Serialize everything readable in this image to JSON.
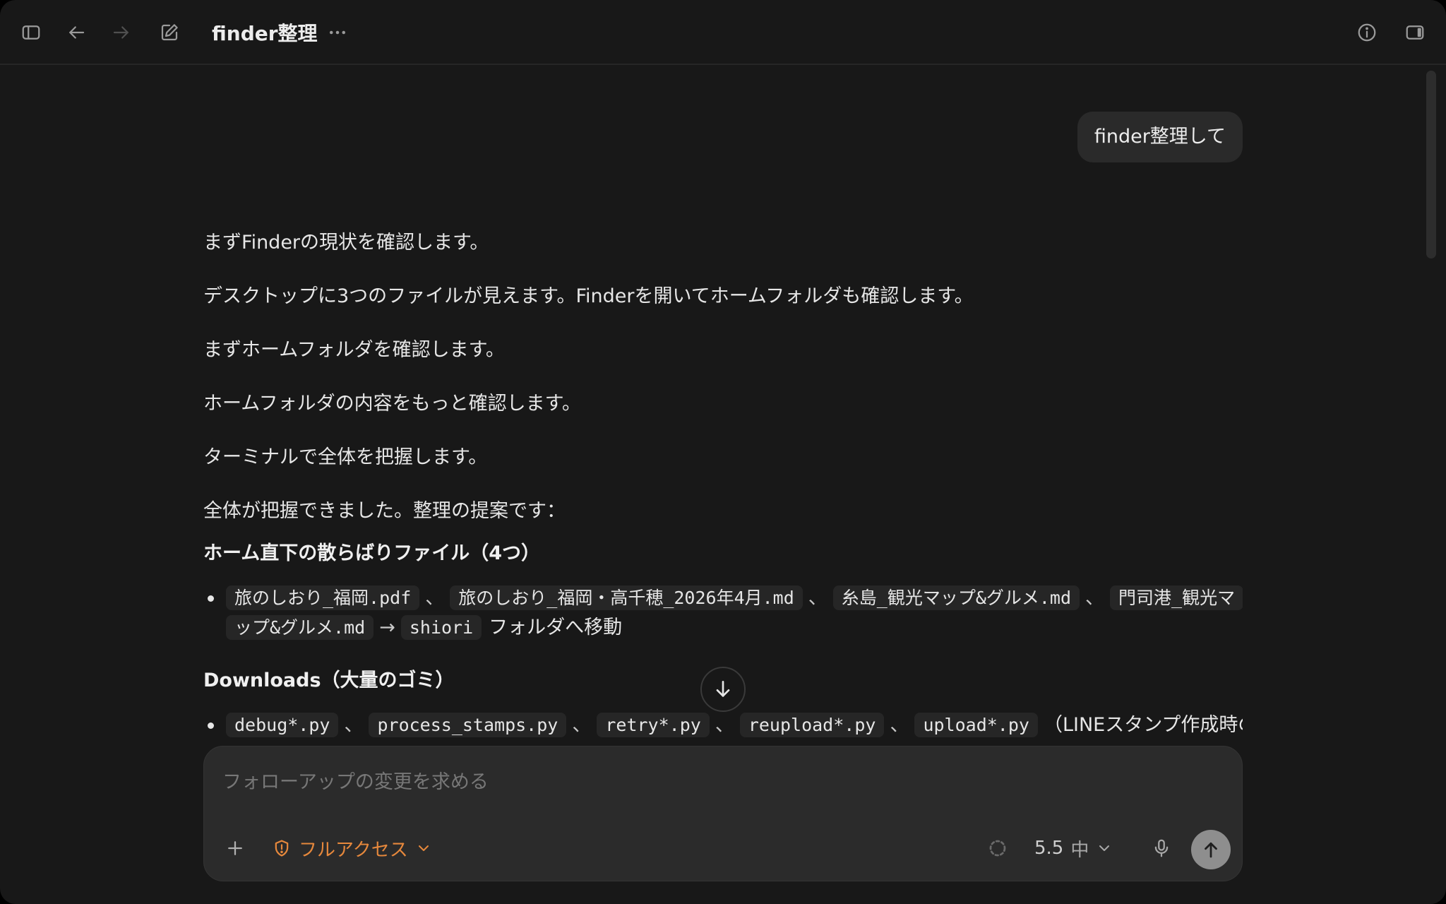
{
  "header": {
    "title": "finder整理"
  },
  "conversation": {
    "user_message": "finder整理して",
    "assistant_lines": [
      "まずFinderの現状を確認します。",
      "デスクトップに3つのファイルが見えます。Finderを開いてホームフォルダも確認します。",
      "まずホームフォルダを確認します。",
      "ホームフォルダの内容をもっと確認します。",
      "ターミナルで全体を把握します。",
      "全体が把握できました。整理の提案です："
    ],
    "section1": {
      "heading": "ホーム直下の散らばりファイル（4つ）",
      "files": [
        "旅のしおり_福岡.pdf",
        "旅のしおり_福岡・高千穂_2026年4月.md",
        "糸島_観光マップ&グルメ.md",
        "門司港_観光マ"
      ],
      "file4_cont": "ップ&グルメ.md",
      "arrow": "→",
      "target": "shiori",
      "action": "フォルダへ移動",
      "sep": "、"
    },
    "section2": {
      "heading": "Downloads（大量のゴミ）",
      "files": [
        "debug*.py",
        "process_stamps.py",
        "retry*.py",
        "reupload*.py",
        "upload*.py"
      ],
      "note": "（LINEスタンプ作成時の",
      "sep": "、"
    }
  },
  "composer": {
    "placeholder": "フォローアップの変更を求める",
    "access_label": "フルアクセス",
    "model_label": "5.5",
    "effort_label": "中"
  }
}
